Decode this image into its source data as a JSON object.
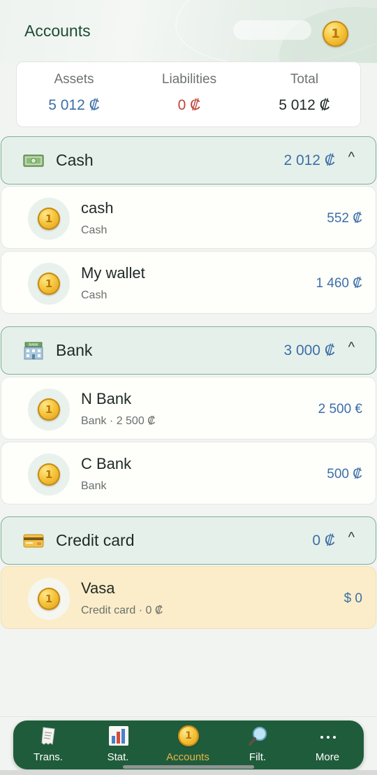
{
  "header": {
    "title": "Accounts"
  },
  "summary": {
    "assets_label": "Assets",
    "assets_value": "5 012 ₡",
    "liabilities_label": "Liabilities",
    "liabilities_value": "0 ₡",
    "total_label": "Total",
    "total_value": "5 012 ₡"
  },
  "groups": [
    {
      "name": "Cash",
      "total": "2 012 ₡",
      "icon": "cash-money-icon",
      "chevron": "^",
      "accounts": [
        {
          "name": "cash",
          "subtitle": "Cash",
          "value": "552 ₡"
        },
        {
          "name": "My wallet",
          "subtitle": "Cash",
          "value": "1 460 ₡"
        }
      ]
    },
    {
      "name": "Bank",
      "total": "3 000 ₡",
      "icon": "bank-building-icon",
      "chevron": "^",
      "accounts": [
        {
          "name": "N Bank",
          "subtitle": "Bank · 2 500 ₡",
          "value": "2 500 €"
        },
        {
          "name": "C Bank",
          "subtitle": "Bank",
          "value": "500 ₡"
        }
      ]
    },
    {
      "name": "Credit card",
      "total": "0 ₡",
      "icon": "credit-card-icon",
      "chevron": "^",
      "accounts": [
        {
          "name": "Vasa",
          "subtitle": "Credit card · 0 ₡",
          "value": "$ 0"
        }
      ]
    }
  ],
  "nav": {
    "items": [
      {
        "label": "Trans.",
        "icon": "receipt-icon"
      },
      {
        "label": "Stat.",
        "icon": "bar-chart-icon"
      },
      {
        "label": "Accounts",
        "icon": "coin-icon",
        "active": true
      },
      {
        "label": "Filt.",
        "icon": "magnifier-icon"
      },
      {
        "label": "More",
        "icon": "more-dots-icon"
      }
    ]
  },
  "colors": {
    "accent_green": "#1f5c3b",
    "asset_blue": "#3c6fa6",
    "liability_red": "#c0433b",
    "active_nav": "#e9b548",
    "credit_row_bg": "#fbedc9"
  }
}
